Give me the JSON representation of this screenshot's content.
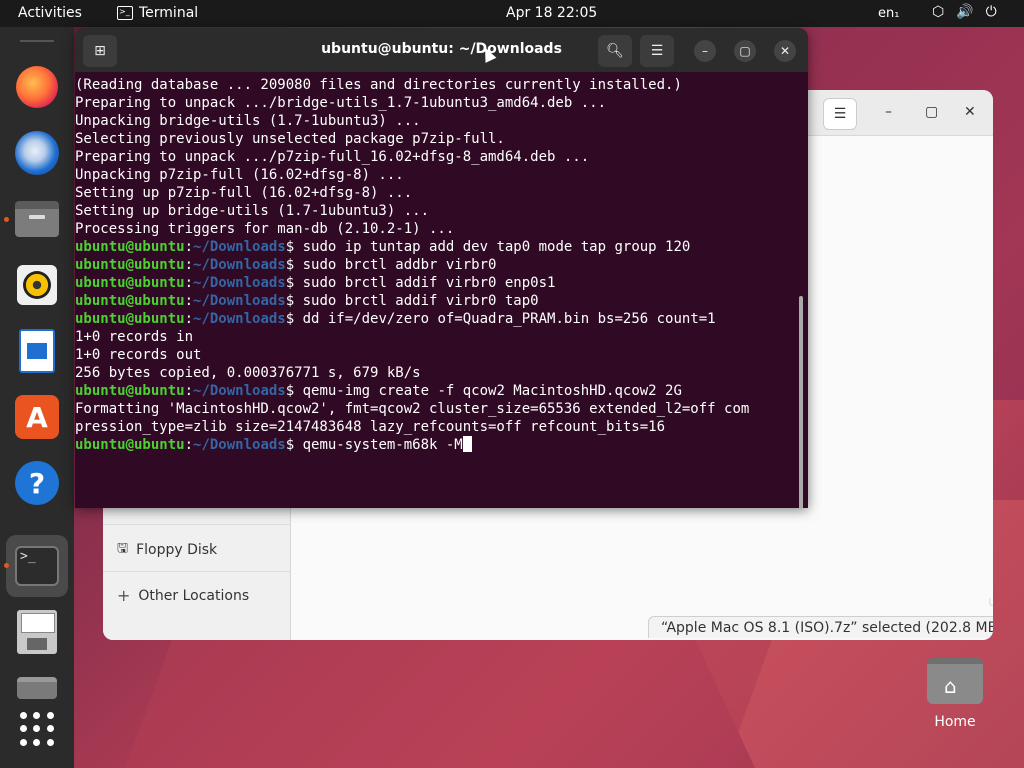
{
  "topbar": {
    "activities": "Activities",
    "app_name": "Terminal",
    "clock": "Apr 18  22:05",
    "lang": "en₁"
  },
  "dock": {
    "items": [
      "firefox",
      "thunderbird",
      "files",
      "rhythmbox",
      "libreoffice-writer",
      "app-center",
      "help",
      "terminal",
      "floppy-disk",
      "drive",
      "show-apps"
    ]
  },
  "files_window": {
    "sidebar": {
      "floppy": "Floppy Disk",
      "other_locations": "Other Locations"
    },
    "status": "“Apple Mac OS 8.1 (ISO).7z” selected  (202.8 MB)",
    "right_cut": "u"
  },
  "terminal": {
    "title": "ubuntu@ubuntu: ~/Downloads",
    "prompt_user": "ubuntu@ubuntu",
    "prompt_colon": ":",
    "prompt_path": "~/Downloads",
    "prompt_dollar": "$ ",
    "lines": [
      {
        "type": "out",
        "text": "(Reading database ... 209080 files and directories currently installed.)"
      },
      {
        "type": "out",
        "text": "Preparing to unpack .../bridge-utils_1.7-1ubuntu3_amd64.deb ..."
      },
      {
        "type": "out",
        "text": "Unpacking bridge-utils (1.7-1ubuntu3) ..."
      },
      {
        "type": "out",
        "text": "Selecting previously unselected package p7zip-full."
      },
      {
        "type": "out",
        "text": "Preparing to unpack .../p7zip-full_16.02+dfsg-8_amd64.deb ..."
      },
      {
        "type": "out",
        "text": "Unpacking p7zip-full (16.02+dfsg-8) ..."
      },
      {
        "type": "out",
        "text": "Setting up p7zip-full (16.02+dfsg-8) ..."
      },
      {
        "type": "out",
        "text": "Setting up bridge-utils (1.7-1ubuntu3) ..."
      },
      {
        "type": "out",
        "text": "Processing triggers for man-db (2.10.2-1) ..."
      },
      {
        "type": "cmd",
        "text": "sudo ip tuntap add dev tap0 mode tap group 120"
      },
      {
        "type": "cmd",
        "text": "sudo brctl addbr virbr0"
      },
      {
        "type": "cmd",
        "text": "sudo brctl addif virbr0 enp0s1"
      },
      {
        "type": "cmd",
        "text": "sudo brctl addif virbr0 tap0"
      },
      {
        "type": "cmd",
        "text": "dd if=/dev/zero of=Quadra_PRAM.bin bs=256 count=1"
      },
      {
        "type": "out",
        "text": "1+0 records in"
      },
      {
        "type": "out",
        "text": "1+0 records out"
      },
      {
        "type": "out",
        "text": "256 bytes copied, 0.000376771 s, 679 kB/s"
      },
      {
        "type": "cmd",
        "text": "qemu-img create -f qcow2 MacintoshHD.qcow2 2G"
      },
      {
        "type": "out",
        "text": "Formatting 'MacintoshHD.qcow2', fmt=qcow2 cluster_size=65536 extended_l2=off com"
      },
      {
        "type": "out",
        "text": "pression_type=zlib size=2147483648 lazy_refcounts=off refcount_bits=16"
      },
      {
        "type": "active",
        "text": "qemu-system-m68k -M"
      }
    ]
  },
  "desktop": {
    "home_label": "Home"
  }
}
